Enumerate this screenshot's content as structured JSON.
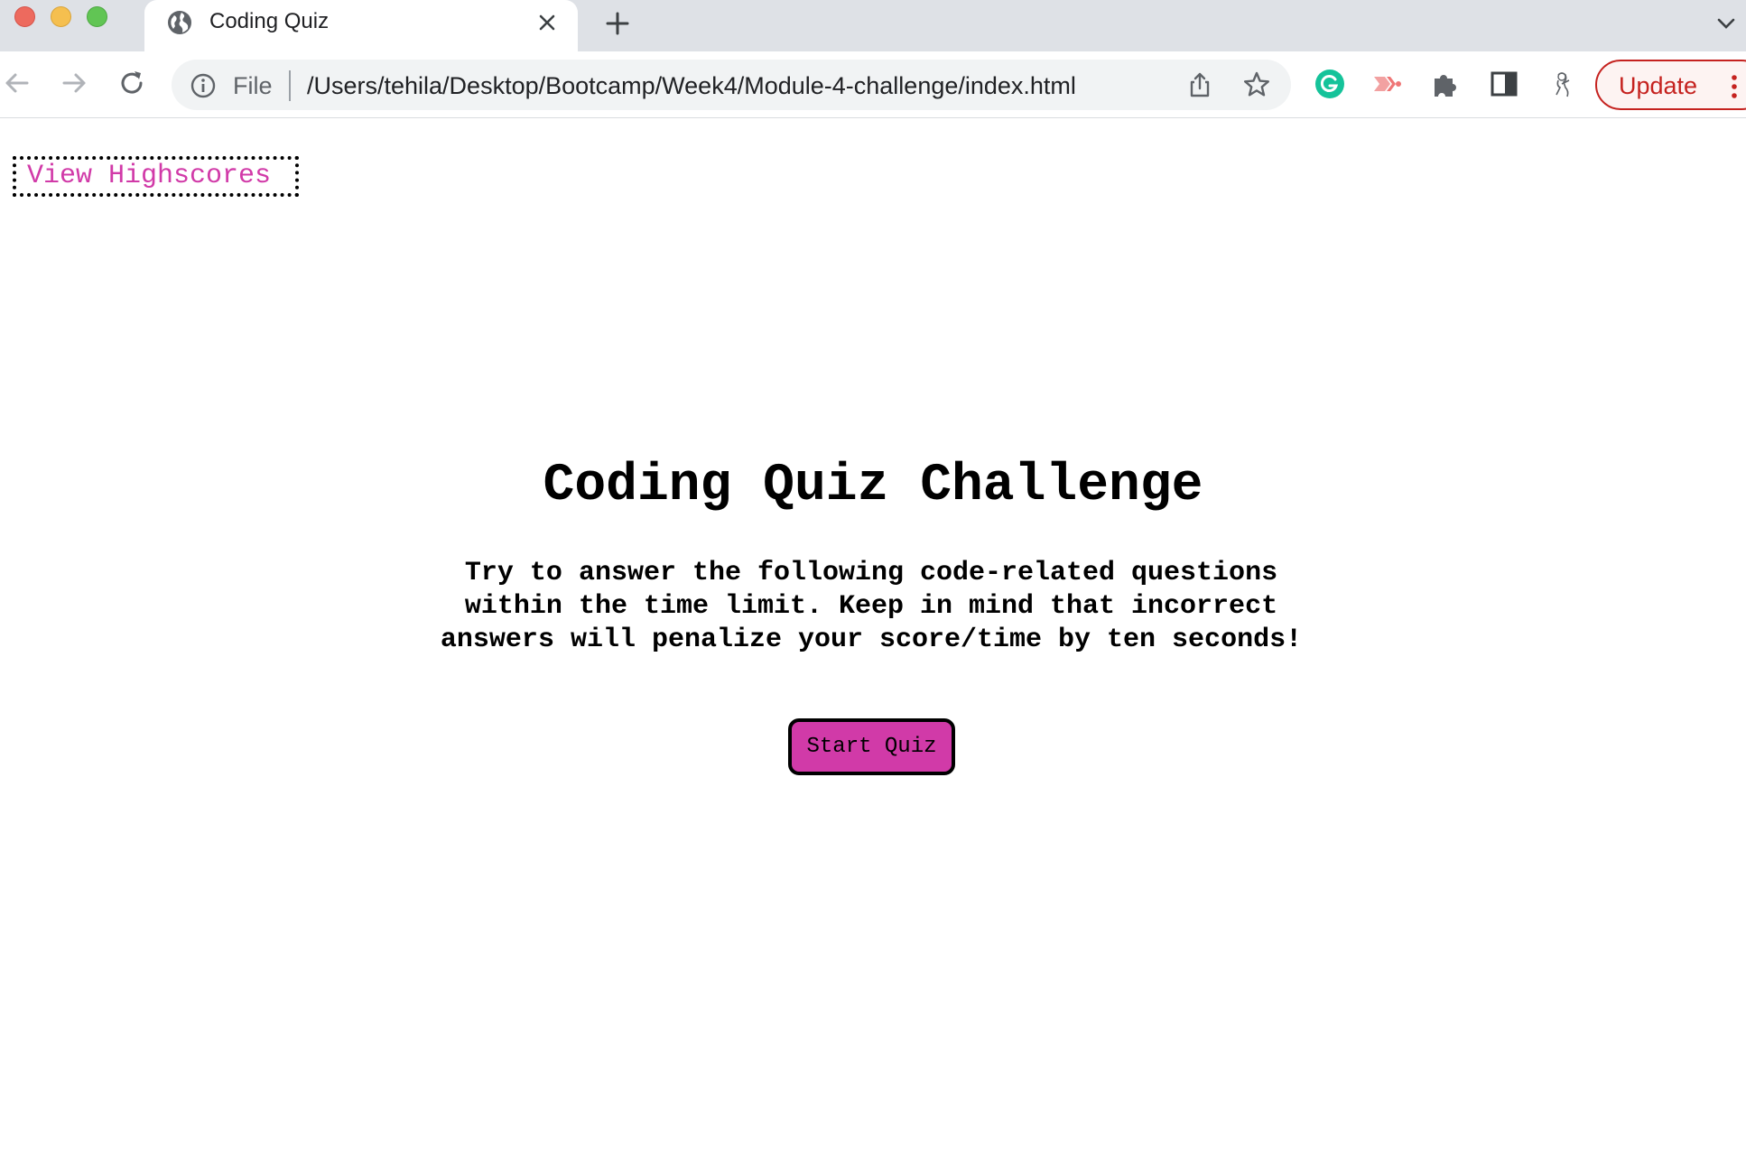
{
  "browser": {
    "tab": {
      "title": "Coding Quiz"
    },
    "omnibox": {
      "scheme": "File",
      "url": "/Users/tehila/Desktop/Bootcamp/Week4/Module-4-challenge/index.html"
    },
    "update_label": "Update",
    "colors": {
      "update": "#c5221f",
      "tabstrip": "#dee1e6"
    }
  },
  "page": {
    "highscores_link": "View Highscores",
    "title": "Coding Quiz Challenge",
    "description": "Try to answer the following code-related questions within the time limit. Keep in mind that incorrect answers will penalize your score/time by ten seconds!",
    "start_button": "Start Quiz",
    "colors": {
      "accent": "#d13aa8"
    }
  },
  "icons": {
    "tab": "globe-icon",
    "tab_close": "close-icon",
    "new_tab": "plus-icon",
    "back": "back-arrow-icon",
    "forward": "forward-arrow-icon",
    "reload": "reload-icon",
    "info": "info-icon",
    "share": "share-icon",
    "bookmark": "star-icon",
    "extensions": [
      "grammarly-icon",
      "cast-icon",
      "puzzle-icon",
      "side-panel-icon",
      "profile-avatar-icon"
    ],
    "menu": "more-vert-icon"
  }
}
